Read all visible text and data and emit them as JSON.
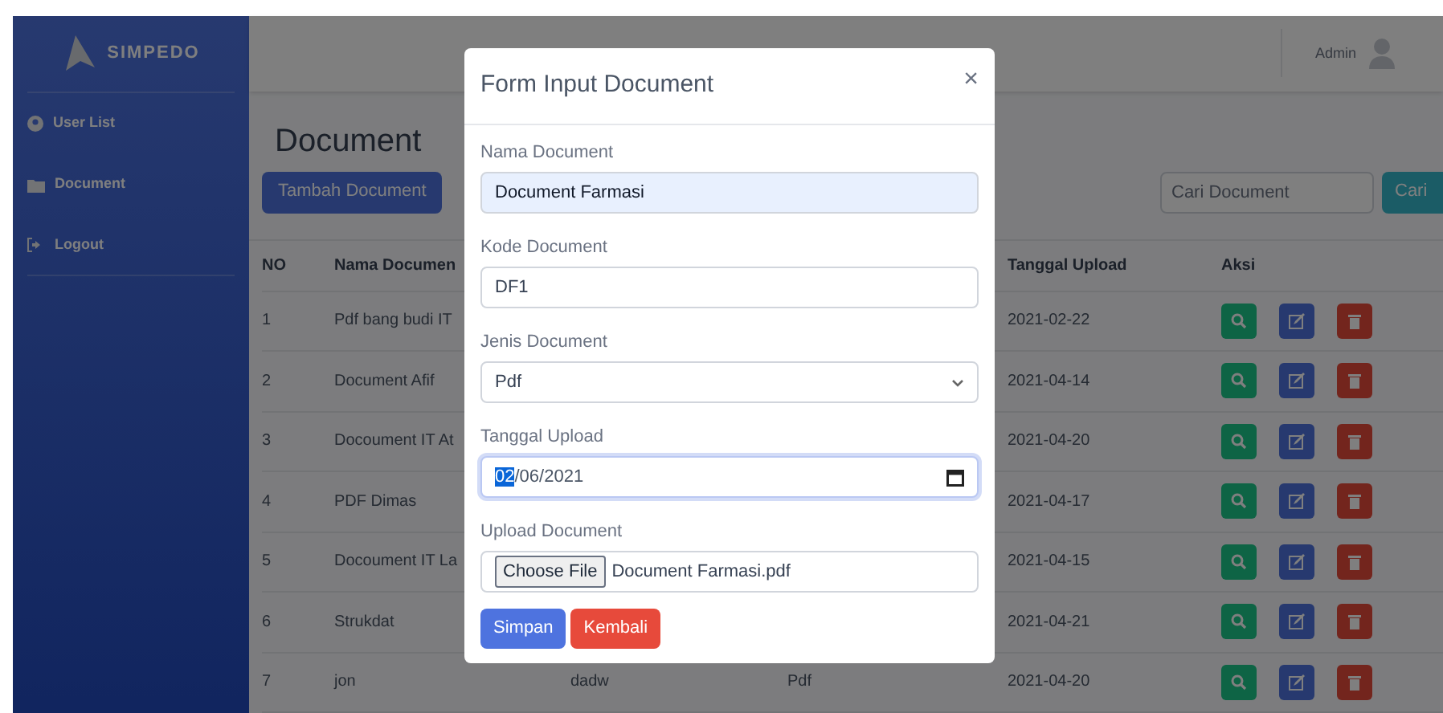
{
  "sidebar": {
    "brand": "SIMPEDO",
    "items": [
      {
        "label": "User List",
        "kind": "users"
      },
      {
        "label": "Document",
        "kind": "folder"
      },
      {
        "label": "Logout",
        "kind": "logout"
      }
    ]
  },
  "topbar": {
    "user": "Admin"
  },
  "page": {
    "title": "Document",
    "add_button": "Tambah Document",
    "search": {
      "placeholder": "Cari Document",
      "button": "Cari"
    }
  },
  "table": {
    "headers": {
      "no": "NO",
      "nama": "Nama Documen",
      "tanggal": "Tanggal Upload",
      "aksi": "Aksi"
    },
    "rows": [
      {
        "no": "1",
        "nama": "Pdf bang budi IT",
        "tanggal": "2021-02-22"
      },
      {
        "no": "2",
        "nama": "Document Afif",
        "tanggal": "2021-04-14"
      },
      {
        "no": "3",
        "nama": "Docoument IT At",
        "tanggal": "2021-04-20"
      },
      {
        "no": "4",
        "nama": "PDF Dimas",
        "tanggal": "2021-04-17"
      },
      {
        "no": "5",
        "nama": "Docoument IT La",
        "tanggal": "2021-04-15"
      },
      {
        "no": "6",
        "nama": "Strukdat",
        "tanggal": "2021-04-21"
      },
      {
        "no": "7",
        "nama": "jon",
        "column_3": "dadw",
        "column_4": "Pdf",
        "tanggal": "2021-04-20"
      }
    ]
  },
  "modal": {
    "title": "Form Input Document",
    "close": "×",
    "fields": [
      {
        "kind": "text",
        "label": "Nama Document",
        "value": "Document Farmasi",
        "autofilled": true,
        "focused": false
      },
      {
        "kind": "text",
        "label": "Kode Document",
        "value": "DF1",
        "autofilled": false,
        "focused": false
      },
      {
        "kind": "select",
        "label": "Jenis Document",
        "value": "Pdf",
        "autofilled": false,
        "focused": false
      },
      {
        "kind": "date",
        "label": "Tanggal Upload",
        "value_parts": [
          {
            "text": "02",
            "selected": true
          },
          {
            "text": "/06/2021",
            "selected": false
          }
        ],
        "autofilled": false,
        "focused": true
      },
      {
        "kind": "file",
        "label": "Upload Document",
        "button": "Choose File",
        "value": "Document Farmasi.pdf",
        "autofilled": false,
        "focused": false
      }
    ],
    "buttons": [
      {
        "label": "Simpan",
        "kind": "primary"
      },
      {
        "label": "Kembali",
        "kind": "danger"
      }
    ]
  }
}
